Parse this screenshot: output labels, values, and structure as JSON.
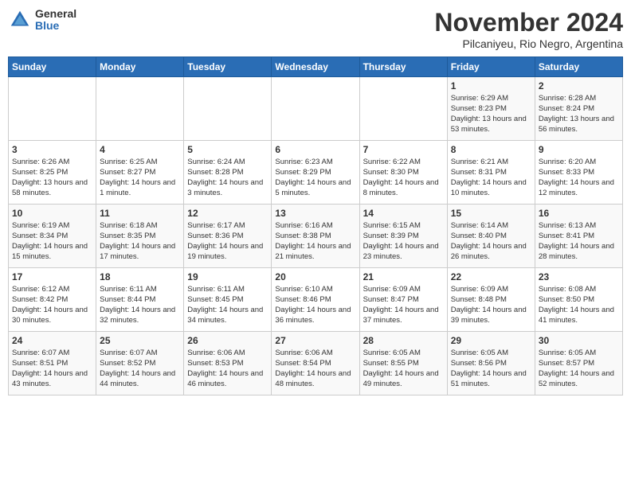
{
  "logo": {
    "general": "General",
    "blue": "Blue"
  },
  "header": {
    "month": "November 2024",
    "location": "Pilcaniyeu, Rio Negro, Argentina"
  },
  "weekdays": [
    "Sunday",
    "Monday",
    "Tuesday",
    "Wednesday",
    "Thursday",
    "Friday",
    "Saturday"
  ],
  "rows": [
    [
      {
        "day": "",
        "info": ""
      },
      {
        "day": "",
        "info": ""
      },
      {
        "day": "",
        "info": ""
      },
      {
        "day": "",
        "info": ""
      },
      {
        "day": "",
        "info": ""
      },
      {
        "day": "1",
        "sunrise": "Sunrise: 6:29 AM",
        "sunset": "Sunset: 8:23 PM",
        "daylight": "Daylight: 13 hours and 53 minutes."
      },
      {
        "day": "2",
        "sunrise": "Sunrise: 6:28 AM",
        "sunset": "Sunset: 8:24 PM",
        "daylight": "Daylight: 13 hours and 56 minutes."
      }
    ],
    [
      {
        "day": "3",
        "sunrise": "Sunrise: 6:26 AM",
        "sunset": "Sunset: 8:25 PM",
        "daylight": "Daylight: 13 hours and 58 minutes."
      },
      {
        "day": "4",
        "sunrise": "Sunrise: 6:25 AM",
        "sunset": "Sunset: 8:27 PM",
        "daylight": "Daylight: 14 hours and 1 minute."
      },
      {
        "day": "5",
        "sunrise": "Sunrise: 6:24 AM",
        "sunset": "Sunset: 8:28 PM",
        "daylight": "Daylight: 14 hours and 3 minutes."
      },
      {
        "day": "6",
        "sunrise": "Sunrise: 6:23 AM",
        "sunset": "Sunset: 8:29 PM",
        "daylight": "Daylight: 14 hours and 5 minutes."
      },
      {
        "day": "7",
        "sunrise": "Sunrise: 6:22 AM",
        "sunset": "Sunset: 8:30 PM",
        "daylight": "Daylight: 14 hours and 8 minutes."
      },
      {
        "day": "8",
        "sunrise": "Sunrise: 6:21 AM",
        "sunset": "Sunset: 8:31 PM",
        "daylight": "Daylight: 14 hours and 10 minutes."
      },
      {
        "day": "9",
        "sunrise": "Sunrise: 6:20 AM",
        "sunset": "Sunset: 8:33 PM",
        "daylight": "Daylight: 14 hours and 12 minutes."
      }
    ],
    [
      {
        "day": "10",
        "sunrise": "Sunrise: 6:19 AM",
        "sunset": "Sunset: 8:34 PM",
        "daylight": "Daylight: 14 hours and 15 minutes."
      },
      {
        "day": "11",
        "sunrise": "Sunrise: 6:18 AM",
        "sunset": "Sunset: 8:35 PM",
        "daylight": "Daylight: 14 hours and 17 minutes."
      },
      {
        "day": "12",
        "sunrise": "Sunrise: 6:17 AM",
        "sunset": "Sunset: 8:36 PM",
        "daylight": "Daylight: 14 hours and 19 minutes."
      },
      {
        "day": "13",
        "sunrise": "Sunrise: 6:16 AM",
        "sunset": "Sunset: 8:38 PM",
        "daylight": "Daylight: 14 hours and 21 minutes."
      },
      {
        "day": "14",
        "sunrise": "Sunrise: 6:15 AM",
        "sunset": "Sunset: 8:39 PM",
        "daylight": "Daylight: 14 hours and 23 minutes."
      },
      {
        "day": "15",
        "sunrise": "Sunrise: 6:14 AM",
        "sunset": "Sunset: 8:40 PM",
        "daylight": "Daylight: 14 hours and 26 minutes."
      },
      {
        "day": "16",
        "sunrise": "Sunrise: 6:13 AM",
        "sunset": "Sunset: 8:41 PM",
        "daylight": "Daylight: 14 hours and 28 minutes."
      }
    ],
    [
      {
        "day": "17",
        "sunrise": "Sunrise: 6:12 AM",
        "sunset": "Sunset: 8:42 PM",
        "daylight": "Daylight: 14 hours and 30 minutes."
      },
      {
        "day": "18",
        "sunrise": "Sunrise: 6:11 AM",
        "sunset": "Sunset: 8:44 PM",
        "daylight": "Daylight: 14 hours and 32 minutes."
      },
      {
        "day": "19",
        "sunrise": "Sunrise: 6:11 AM",
        "sunset": "Sunset: 8:45 PM",
        "daylight": "Daylight: 14 hours and 34 minutes."
      },
      {
        "day": "20",
        "sunrise": "Sunrise: 6:10 AM",
        "sunset": "Sunset: 8:46 PM",
        "daylight": "Daylight: 14 hours and 36 minutes."
      },
      {
        "day": "21",
        "sunrise": "Sunrise: 6:09 AM",
        "sunset": "Sunset: 8:47 PM",
        "daylight": "Daylight: 14 hours and 37 minutes."
      },
      {
        "day": "22",
        "sunrise": "Sunrise: 6:09 AM",
        "sunset": "Sunset: 8:48 PM",
        "daylight": "Daylight: 14 hours and 39 minutes."
      },
      {
        "day": "23",
        "sunrise": "Sunrise: 6:08 AM",
        "sunset": "Sunset: 8:50 PM",
        "daylight": "Daylight: 14 hours and 41 minutes."
      }
    ],
    [
      {
        "day": "24",
        "sunrise": "Sunrise: 6:07 AM",
        "sunset": "Sunset: 8:51 PM",
        "daylight": "Daylight: 14 hours and 43 minutes."
      },
      {
        "day": "25",
        "sunrise": "Sunrise: 6:07 AM",
        "sunset": "Sunset: 8:52 PM",
        "daylight": "Daylight: 14 hours and 44 minutes."
      },
      {
        "day": "26",
        "sunrise": "Sunrise: 6:06 AM",
        "sunset": "Sunset: 8:53 PM",
        "daylight": "Daylight: 14 hours and 46 minutes."
      },
      {
        "day": "27",
        "sunrise": "Sunrise: 6:06 AM",
        "sunset": "Sunset: 8:54 PM",
        "daylight": "Daylight: 14 hours and 48 minutes."
      },
      {
        "day": "28",
        "sunrise": "Sunrise: 6:05 AM",
        "sunset": "Sunset: 8:55 PM",
        "daylight": "Daylight: 14 hours and 49 minutes."
      },
      {
        "day": "29",
        "sunrise": "Sunrise: 6:05 AM",
        "sunset": "Sunset: 8:56 PM",
        "daylight": "Daylight: 14 hours and 51 minutes."
      },
      {
        "day": "30",
        "sunrise": "Sunrise: 6:05 AM",
        "sunset": "Sunset: 8:57 PM",
        "daylight": "Daylight: 14 hours and 52 minutes."
      }
    ]
  ]
}
